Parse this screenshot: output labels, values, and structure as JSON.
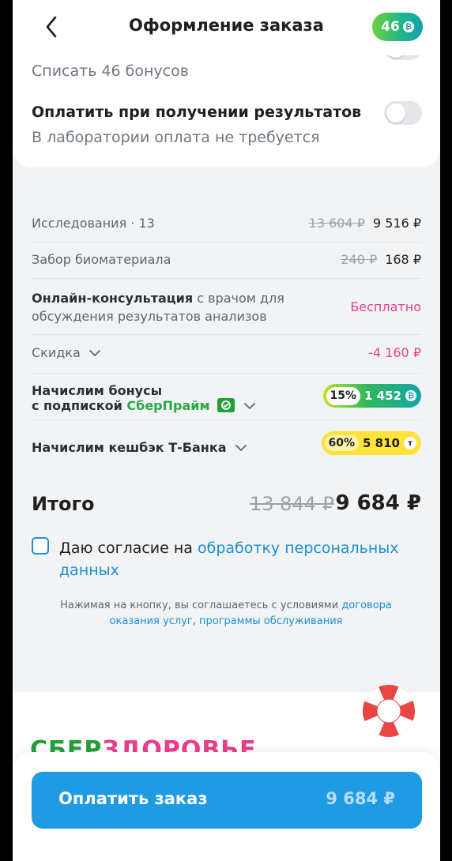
{
  "header": {
    "title": "Оформление заказа",
    "bonus_balance": "46"
  },
  "bonuses": {
    "spend_label": "Списать 46 бонусов"
  },
  "pay_on_result": {
    "title": "Оплатить при получении результатов",
    "subtitle": "В лаборатории оплата не требуется",
    "enabled": false
  },
  "summary": {
    "research": {
      "label": "Исследования · 13",
      "old": "13 604 ₽",
      "new": "9 516 ₽"
    },
    "sampling": {
      "label": "Забор биоматериала",
      "old": "240 ₽",
      "new": "168 ₽"
    },
    "consult": {
      "bold": "Онлайн-консультация",
      "rest": " с врачом для обсуждения результатов анализов",
      "value": "Бесплатно"
    },
    "discount": {
      "label": "Скидка",
      "value": "-4 160 ₽"
    },
    "sber_bonus": {
      "line1": "Начислим бонусы",
      "line2_prefix": "с подпиской ",
      "line2_brand": "СберПрайм",
      "percent": "15%",
      "amount": "1 452"
    },
    "cashback": {
      "label": "Начислим кешбэк Т-Банка",
      "percent": "60%",
      "amount": "5 810"
    }
  },
  "total": {
    "label": "Итого",
    "old": "13 844 ₽",
    "new": "9 684 ₽"
  },
  "consent": {
    "prefix": "Даю согласие на ",
    "link": "обработку персональных данных"
  },
  "terms": {
    "prefix": "Нажимая на кнопку, вы соглашаетесь с условиями ",
    "link1": "договора оказания услуг",
    "sep": ", ",
    "link2": "программы обслуживания"
  },
  "brand": {
    "part1": "СБЕР",
    "part2": "ЗДОРОВЬЕ"
  },
  "pay_button": {
    "label": "Оплатить заказ",
    "amount": "9 684 ₽"
  },
  "colors": {
    "accent": "#1e9be3",
    "pink": "#e83e8c",
    "green": "#21a038"
  }
}
